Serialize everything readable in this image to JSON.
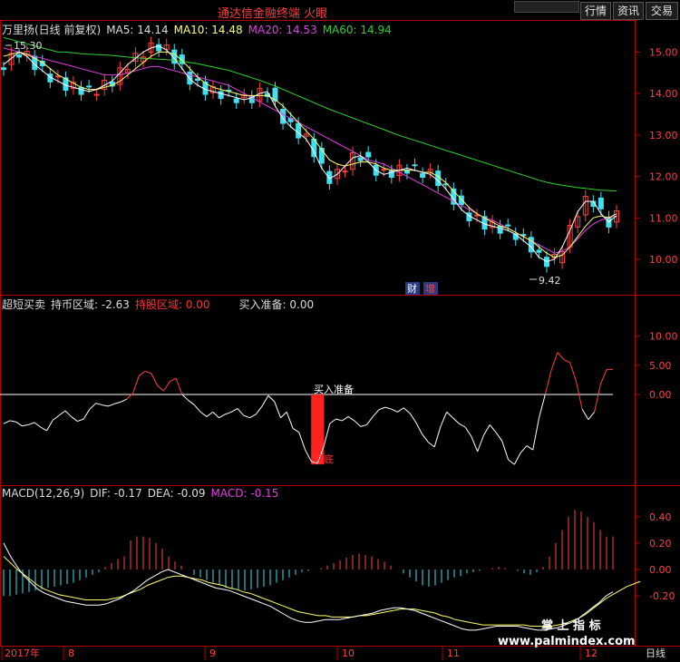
{
  "app": {
    "title": "通达信金融终端  火眼"
  },
  "toolbar": {
    "buttons": [
      "行情",
      "资讯",
      "交易"
    ]
  },
  "main": {
    "stock_label": "万里扬(日线 前复权)",
    "ma5": "MA5: 14.14",
    "ma10": "MA10: 14.48",
    "ma20": "MA20: 14.53",
    "ma60": "MA60: 14.94",
    "high_label": "15.30",
    "low_label": "9.42",
    "badge_cai": "财",
    "badge_zeng": "增",
    "colors": {
      "ma5": "#ffffff",
      "ma10": "#ffff66",
      "ma20": "#e040e0",
      "ma60": "#30d030",
      "up": "#ff4040",
      "down": "#40e0f0"
    }
  },
  "panel2": {
    "name": "超短买卖",
    "l1": "持币区域: -2.63",
    "l2": "持股区域: 0.00",
    "l3": "买入准备: 0.00",
    "annotation_top": "买入准备",
    "annotation_bottom": "短底"
  },
  "panel3": {
    "name": "MACD(12,26,9)",
    "dif": "DIF: -0.17",
    "dea": "DEA: -0.09",
    "macd": "MACD: -0.15"
  },
  "xaxis": {
    "labels": [
      "2017年",
      "8",
      "9",
      "10",
      "11",
      "12"
    ],
    "period": "日线"
  },
  "watermark": {
    "line1": "掌 上 指 标",
    "line2": "www.palmindex.com"
  },
  "chart_data": [
    {
      "type": "candlestick",
      "title": "万里扬(日线 前复权)",
      "ylim": [
        9.3,
        15.6
      ],
      "yticks": [
        10.0,
        11.0,
        12.0,
        13.0,
        14.0,
        15.0
      ],
      "ma5": [
        14.7,
        14.85,
        15.0,
        14.9,
        14.7,
        14.55,
        14.4,
        14.3,
        14.2,
        14.15,
        14.1,
        14.05,
        14.1,
        14.2,
        14.3,
        14.5,
        14.7,
        14.85,
        15.0,
        15.1,
        15.15,
        15.05,
        14.85,
        14.6,
        14.35,
        14.2,
        14.1,
        14.05,
        14.0,
        13.95,
        13.9,
        13.85,
        13.9,
        14.0,
        14.05,
        13.7,
        13.4,
        13.2,
        13.05,
        12.9,
        12.6,
        12.2,
        11.95,
        12.05,
        12.25,
        12.45,
        12.5,
        12.35,
        12.15,
        12.05,
        12.1,
        12.15,
        12.2,
        12.15,
        12.1,
        12.05,
        11.9,
        11.7,
        11.45,
        11.2,
        11.05,
        10.95,
        10.85,
        10.8,
        10.75,
        10.7,
        10.6,
        10.45,
        10.3,
        10.05,
        9.95,
        10.0,
        10.3,
        10.7,
        11.15,
        11.4,
        11.4,
        11.1,
        10.9,
        11.05
      ],
      "ma10": [
        14.9,
        14.95,
        15.0,
        14.95,
        14.85,
        14.75,
        14.6,
        14.45,
        14.35,
        14.25,
        14.15,
        14.1,
        14.1,
        14.15,
        14.2,
        14.3,
        14.45,
        14.6,
        14.75,
        14.9,
        15.0,
        15.0,
        14.95,
        14.8,
        14.6,
        14.4,
        14.25,
        14.15,
        14.1,
        14.05,
        14.0,
        13.95,
        13.95,
        13.95,
        13.95,
        13.85,
        13.7,
        13.5,
        13.3,
        13.1,
        12.9,
        12.65,
        12.4,
        12.3,
        12.25,
        12.3,
        12.35,
        12.35,
        12.3,
        12.2,
        12.15,
        12.15,
        12.15,
        12.15,
        12.1,
        12.1,
        12.0,
        11.85,
        11.65,
        11.45,
        11.25,
        11.1,
        11.0,
        10.9,
        10.8,
        10.75,
        10.65,
        10.55,
        10.45,
        10.3,
        10.15,
        10.05,
        10.1,
        10.3,
        10.55,
        10.8,
        11.0,
        11.05,
        11.0,
        11.1
      ],
      "ma20": [
        15.1,
        15.05,
        15.0,
        14.95,
        14.9,
        14.85,
        14.8,
        14.75,
        14.7,
        14.65,
        14.6,
        14.55,
        14.5,
        14.45,
        14.45,
        14.45,
        14.5,
        14.55,
        14.6,
        14.65,
        14.65,
        14.6,
        14.55,
        14.5,
        14.45,
        14.4,
        14.35,
        14.3,
        14.25,
        14.2,
        14.1,
        14.0,
        13.9,
        13.8,
        13.7,
        13.6,
        13.5,
        13.4,
        13.3,
        13.2,
        13.1,
        13.0,
        12.9,
        12.8,
        12.7,
        12.6,
        12.5,
        12.4,
        12.35,
        12.3,
        12.2,
        12.1,
        12.0,
        11.9,
        11.8,
        11.7,
        11.6,
        11.5,
        11.4,
        11.3,
        11.2,
        11.1,
        11.0,
        10.95,
        10.85,
        10.75,
        10.65,
        10.55,
        10.45,
        10.35,
        10.25,
        10.15,
        10.2,
        10.3,
        10.5,
        10.7,
        10.85,
        10.95,
        11.0,
        11.05
      ],
      "ma60": [
        15.35,
        15.3,
        15.25,
        15.2,
        15.15,
        15.1,
        15.05,
        15.0,
        15.0,
        14.98,
        14.96,
        14.95,
        14.94,
        14.93,
        14.92,
        14.9,
        14.88,
        14.86,
        14.85,
        14.84,
        14.83,
        14.82,
        14.8,
        14.78,
        14.75,
        14.72,
        14.68,
        14.64,
        14.6,
        14.56,
        14.5,
        14.44,
        14.38,
        14.32,
        14.25,
        14.18,
        14.1,
        14.02,
        13.94,
        13.86,
        13.78,
        13.7,
        13.62,
        13.55,
        13.48,
        13.41,
        13.34,
        13.27,
        13.2,
        13.13,
        13.06,
        12.99,
        12.93,
        12.87,
        12.81,
        12.75,
        12.69,
        12.63,
        12.57,
        12.51,
        12.45,
        12.39,
        12.33,
        12.27,
        12.21,
        12.15,
        12.09,
        12.03,
        11.97,
        11.91,
        11.86,
        11.82,
        11.79,
        11.76,
        11.73,
        11.71,
        11.69,
        11.67,
        11.66,
        11.65
      ],
      "high": 15.3,
      "low": 9.42
    },
    {
      "type": "line",
      "title": "超短买卖",
      "ylim": [
        -5,
        15
      ],
      "yticks": [
        0.0,
        5.0,
        10.0
      ],
      "threshold": 0,
      "values": [
        -5.0,
        -4.5,
        -4.7,
        -5.4,
        -5.2,
        -4.8,
        -5.6,
        -6.2,
        -4.4,
        -3.6,
        -2.8,
        -3.8,
        -4.6,
        -4.2,
        -2.5,
        -1.5,
        -1.8,
        -2.0,
        -1.6,
        -1.3,
        -0.8,
        0.2,
        3.2,
        4.0,
        3.6,
        1.5,
        0.6,
        2.2,
        2.8,
        0.0,
        -1.0,
        -1.8,
        -3.0,
        -3.8,
        -3.0,
        -4.0,
        -3.4,
        -3.0,
        -2.4,
        -3.6,
        -4.0,
        -3.4,
        -2.0,
        -0.2,
        -1.2,
        -4.0,
        -3.0,
        -5.8,
        -6.5,
        -9.5,
        -11.5,
        -11.8,
        -9.0,
        -5.0,
        -4.2,
        -4.5,
        -3.8,
        -4.5,
        -5.5,
        -5.2,
        -3.8,
        -2.6,
        -2.2,
        -2.5,
        -3.0,
        -2.3,
        -3.2,
        -4.8,
        -6.8,
        -8.2,
        -9.0,
        -5.5,
        -3.0,
        -4.0,
        -5.0,
        -5.6,
        -7.2,
        -9.8,
        -7.0,
        -5.2,
        -6.5,
        -8.0,
        -11.2,
        -12.0,
        -10.0,
        -8.8,
        -9.5,
        -4.0,
        0.0,
        4.2,
        7.2,
        6.0,
        5.5,
        2.4,
        -2.5,
        -4.3,
        -3.0,
        1.8,
        4.3,
        4.3
      ],
      "bar_label": "短底"
    },
    {
      "type": "bar",
      "title": "MACD(12,26,9)",
      "ylim": [
        -0.4,
        0.5
      ],
      "yticks": [
        -0.2,
        0.0,
        0.2,
        0.4
      ],
      "macd": [
        -0.2,
        -0.2,
        -0.19,
        -0.18,
        -0.17,
        -0.16,
        -0.15,
        -0.14,
        -0.13,
        -0.12,
        -0.11,
        -0.1,
        -0.08,
        -0.06,
        -0.04,
        -0.02,
        0.02,
        0.05,
        0.08,
        0.1,
        0.22,
        0.25,
        0.25,
        0.24,
        0.2,
        0.16,
        0.1,
        0.06,
        0.03,
        0.0,
        -0.04,
        -0.06,
        -0.08,
        -0.1,
        -0.12,
        -0.14,
        -0.15,
        -0.15,
        -0.16,
        -0.15,
        -0.14,
        -0.13,
        -0.12,
        -0.1,
        -0.08,
        -0.06,
        -0.04,
        -0.02,
        -0.01,
        0.0,
        0.01,
        0.03,
        0.05,
        0.07,
        0.09,
        0.11,
        0.12,
        0.11,
        0.1,
        0.08,
        0.06,
        0.03,
        0.0,
        -0.03,
        -0.06,
        -0.09,
        -0.12,
        -0.13,
        -0.12,
        -0.1,
        -0.08,
        -0.06,
        -0.05,
        -0.03,
        -0.02,
        -0.01,
        0.0,
        0.01,
        0.02,
        0.01,
        0.0,
        -0.01,
        -0.03,
        -0.04,
        -0.02,
        0.02,
        0.1,
        0.2,
        0.3,
        0.4,
        0.45,
        0.44,
        0.4,
        0.36,
        0.3,
        0.25,
        0.25
      ],
      "dif": [
        0.2,
        0.1,
        0.02,
        -0.05,
        -0.1,
        -0.15,
        -0.18,
        -0.2,
        -0.22,
        -0.24,
        -0.25,
        -0.26,
        -0.27,
        -0.27,
        -0.27,
        -0.26,
        -0.24,
        -0.22,
        -0.19,
        -0.16,
        -0.12,
        -0.08,
        -0.05,
        -0.02,
        0.0,
        -0.02,
        -0.04,
        -0.06,
        -0.08,
        -0.1,
        -0.12,
        -0.14,
        -0.15,
        -0.16,
        -0.18,
        -0.2,
        -0.22,
        -0.24,
        -0.26,
        -0.28,
        -0.31,
        -0.34,
        -0.37,
        -0.39,
        -0.4,
        -0.4,
        -0.39,
        -0.38,
        -0.38,
        -0.38,
        -0.37,
        -0.36,
        -0.35,
        -0.34,
        -0.33,
        -0.31,
        -0.3,
        -0.29,
        -0.29,
        -0.3,
        -0.31,
        -0.33,
        -0.35,
        -0.37,
        -0.39,
        -0.41,
        -0.43,
        -0.45,
        -0.46,
        -0.46,
        -0.45,
        -0.44,
        -0.43,
        -0.43,
        -0.43,
        -0.43,
        -0.44,
        -0.45,
        -0.46,
        -0.46,
        -0.45,
        -0.44,
        -0.42,
        -0.4,
        -0.37,
        -0.33,
        -0.29,
        -0.25,
        -0.2,
        -0.17
      ],
      "dea": [
        0.1,
        0.05,
        0.0,
        -0.04,
        -0.08,
        -0.12,
        -0.15,
        -0.17,
        -0.19,
        -0.2,
        -0.21,
        -0.22,
        -0.23,
        -0.23,
        -0.23,
        -0.23,
        -0.22,
        -0.21,
        -0.19,
        -0.17,
        -0.15,
        -0.12,
        -0.1,
        -0.08,
        -0.06,
        -0.05,
        -0.05,
        -0.06,
        -0.07,
        -0.08,
        -0.1,
        -0.11,
        -0.12,
        -0.14,
        -0.15,
        -0.17,
        -0.18,
        -0.2,
        -0.22,
        -0.24,
        -0.26,
        -0.28,
        -0.3,
        -0.32,
        -0.33,
        -0.34,
        -0.35,
        -0.35,
        -0.36,
        -0.36,
        -0.36,
        -0.36,
        -0.35,
        -0.35,
        -0.34,
        -0.33,
        -0.32,
        -0.31,
        -0.3,
        -0.3,
        -0.3,
        -0.31,
        -0.32,
        -0.33,
        -0.35,
        -0.36,
        -0.38,
        -0.39,
        -0.4,
        -0.41,
        -0.42,
        -0.42,
        -0.42,
        -0.42,
        -0.42,
        -0.42,
        -0.42,
        -0.43,
        -0.43,
        -0.43,
        -0.43,
        -0.42,
        -0.41,
        -0.39,
        -0.37,
        -0.34,
        -0.3,
        -0.26,
        -0.22,
        -0.19,
        -0.16,
        -0.13,
        -0.11,
        -0.09
      ]
    }
  ]
}
